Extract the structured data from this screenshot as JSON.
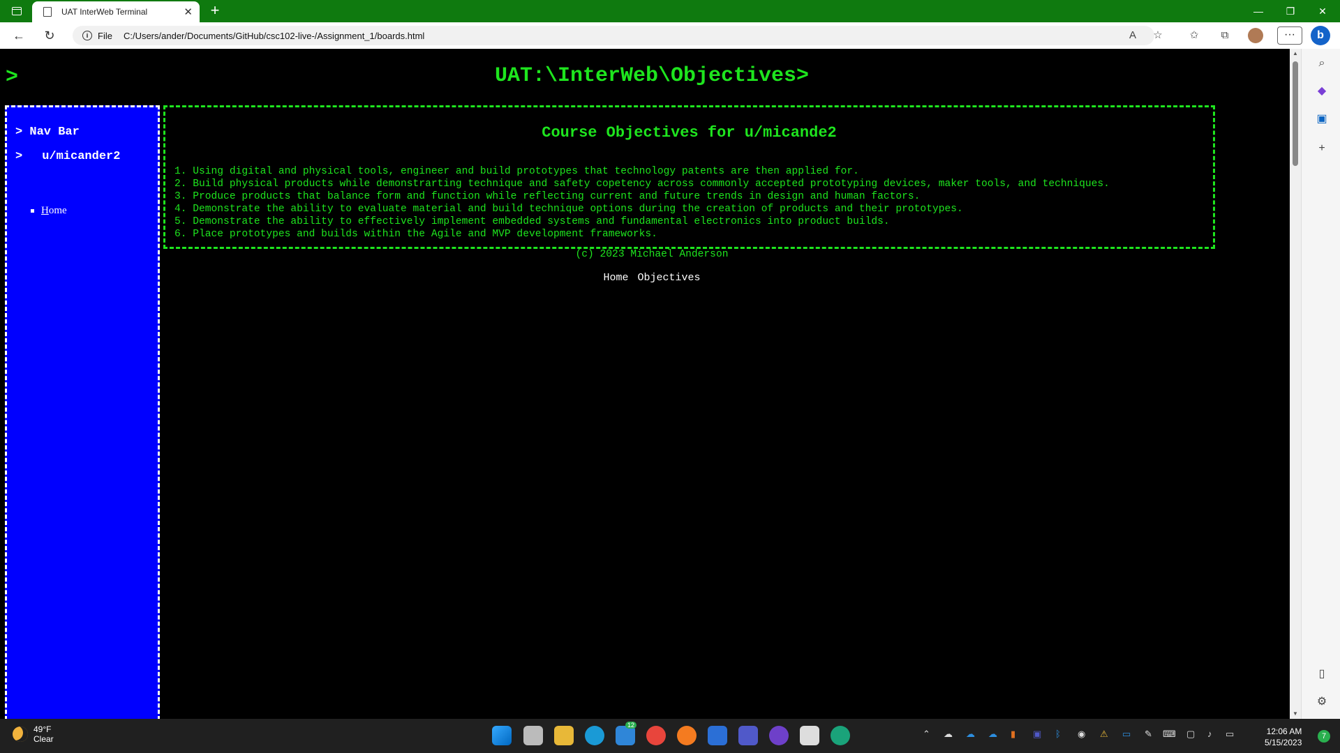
{
  "browser": {
    "tab_title": "UAT InterWeb Terminal",
    "tab_close": "✕",
    "new_tab": "+",
    "address_scheme": "File",
    "address_url": "C:/Users/ander/Documents/GitHub/csc102-live-/Assignment_1/boards.html",
    "more_menu": "···",
    "copilot": "b"
  },
  "page": {
    "prompt": ">",
    "heading": "UAT:\\InterWeb\\Objectives>",
    "sidebar": {
      "nav_heading": "> Nav Bar",
      "user_arrow": ">",
      "username": "u/micander2",
      "home_first": "H",
      "home_rest": "ome"
    },
    "content": {
      "title": "Course Objectives for u/micande2",
      "objectives": [
        "1. Using digital and physical tools, engineer and build prototypes that technology patents are then applied for.",
        "2. Build physical products while demonstrarting technique and safety copetency across commonly accepted prototyping devices, maker tools, and techniques.",
        "3. Produce products that balance form and function while reflecting current and future trends in design and human factors.",
        "4. Demonstrate the ability to evaluate material and build technique options during the creation of products and their prototypes.",
        "5. Demonstrate the ability to effectively implement embedded systems and fundamental electronics into product builds.",
        "6. Place prototypes and builds within the Agile and MVP development frameworks."
      ]
    },
    "copyright": "(c) 2023 Michael Anderson",
    "footer_links": [
      "Home",
      "Objectives"
    ]
  },
  "taskbar": {
    "weather_temp": "49°F",
    "weather_desc": "Clear",
    "badge_count": "12",
    "time": "12:06 AM",
    "date": "5/15/2023",
    "notification_count": "7"
  },
  "colors": {
    "terminal_green": "#1ee51e",
    "sidebar_blue": "#0000ff",
    "tabbar_green": "#0f7a0f"
  },
  "icons": [
    "window-icon",
    "page-icon",
    "back-arrow-icon",
    "refresh-icon",
    "info-icon",
    "read-aloud-icon",
    "favorite-add-icon",
    "favorites-icon",
    "collections-icon",
    "search-icon",
    "copilot-icon",
    "outlook-icon",
    "add-icon",
    "settings-icon",
    "moon-icon"
  ]
}
